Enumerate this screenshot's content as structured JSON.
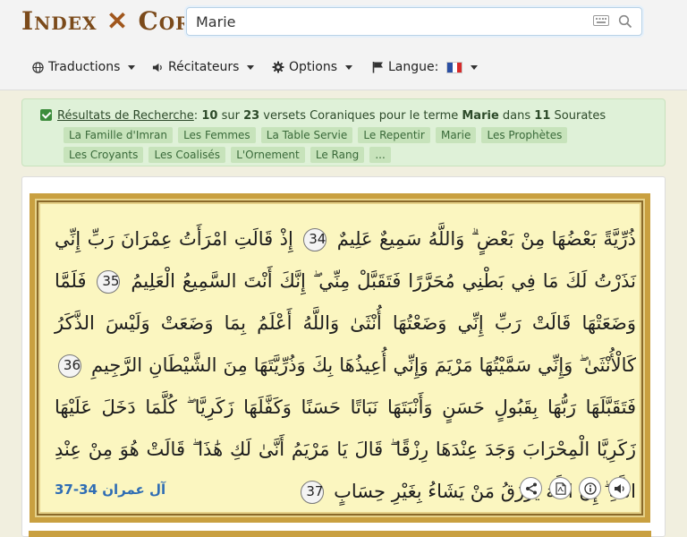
{
  "logo": {
    "first": "Index",
    "second": "Coran"
  },
  "search": {
    "value": "Marie"
  },
  "nav": [
    {
      "label": "Traductions"
    },
    {
      "label": "Récitateurs"
    },
    {
      "label": "Options"
    },
    {
      "label": "Langue:"
    }
  ],
  "results": {
    "link_label": "Résultats de Recherche",
    "colon": ":",
    "count": "10",
    "sur": "sur",
    "total": "23",
    "phrase": "versets Coraniques pour le terme",
    "term": "Marie",
    "dans": "dans",
    "sourates": "11",
    "sourates_label": "Sourates",
    "tags": [
      "La Famille d'Imran",
      "Les Femmes",
      "La Table Servie",
      "Le Repentir",
      "Marie",
      "Les Prophètes",
      "Les Croyants",
      "Les Coalisés",
      "L'Ornement",
      "Le Rang",
      "..."
    ]
  },
  "verse": {
    "segments": [
      {
        "text": "ذُرِّيَّةً بَعْضُهَا مِنْ بَعْضٍ ۗ وَاللَّهُ سَمِيعٌ عَلِيمٌ",
        "num": "34"
      },
      {
        "text": "إِذْ قَالَتِ امْرَأَتُ عِمْرَانَ رَبِّ إِنِّي نَذَرْتُ لَكَ مَا فِي بَطْنِي مُحَرَّرًا فَتَقَبَّلْ مِنِّي ۖ إِنَّكَ أَنْتَ السَّمِيعُ الْعَلِيمُ",
        "num": "35"
      },
      {
        "text": "فَلَمَّا وَضَعَتْهَا قَالَتْ رَبِّ إِنِّي وَضَعْتُهَا أُنْثَىٰ وَاللَّهُ أَعْلَمُ بِمَا وَضَعَتْ وَلَيْسَ الذَّكَرُ كَالْأُنْثَىٰ ۖ وَإِنِّي سَمَّيْتُهَا مَرْيَمَ وَإِنِّي أُعِيذُهَا بِكَ وَذُرِّيَّتَهَا مِنَ الشَّيْطَانِ الرَّجِيمِ",
        "num": "36"
      },
      {
        "text": "فَتَقَبَّلَهَا رَبُّهَا بِقَبُولٍ حَسَنٍ وَأَنْبَتَهَا نَبَاتًا حَسَنًا وَكَفَّلَهَا زَكَرِيَّا ۖ كُلَّمَا دَخَلَ عَلَيْهَا زَكَرِيَّا الْمِحْرَابَ وَجَدَ عِنْدَهَا رِزْقًا ۖ قَالَ يَا مَرْيَمُ أَنَّىٰ لَكِ هَٰذَا ۖ قَالَتْ هُوَ مِنْ عِنْدِ اللَّهِ ۖ إِنَّ اللَّهَ يَرْزُقُ مَنْ يَشَاءُ بِغَيْرِ حِسَابٍ",
        "num": "37"
      }
    ],
    "reference": "آل عمران 34-37"
  },
  "colors": {
    "logo": "#7b4a1a",
    "result_bg": "#dff1d8",
    "tag_bg": "#c7e3bb",
    "frame": "#c9a040",
    "verse_bg": "#fbf6c0",
    "reference": "#2f6db4"
  },
  "icons": {
    "nav": [
      "globe-icon",
      "speaker-icon",
      "gear-icon",
      "flag-icon"
    ],
    "actions": [
      "share-icon",
      "pdf-icon",
      "info-icon",
      "audio-icon"
    ]
  }
}
